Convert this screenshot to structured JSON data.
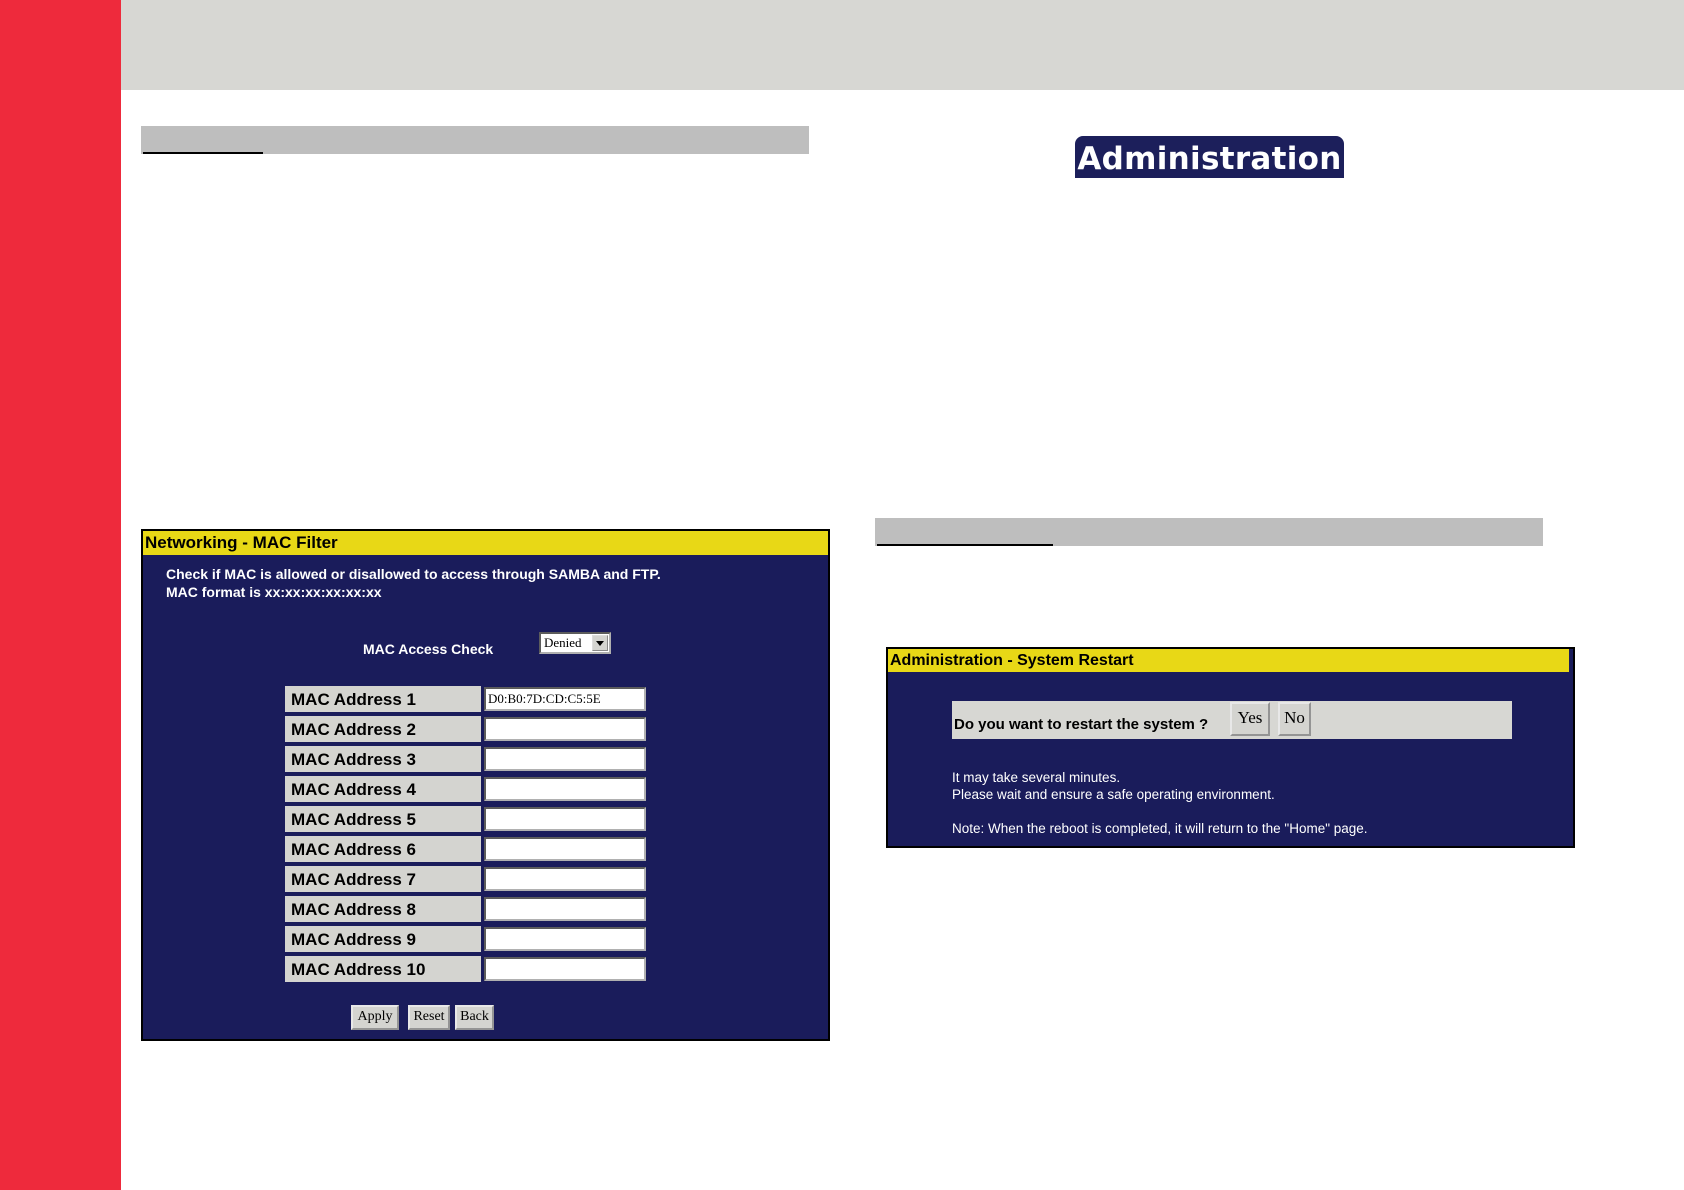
{
  "left_section": {
    "mac_filter": {
      "title": "Networking - MAC Filter",
      "description_line1": "Check if MAC is allowed or disallowed to access through SAMBA and FTP.",
      "description_line2": "MAC format is xx:xx:xx:xx:xx:xx",
      "access_check_label": "MAC Access Check",
      "access_check_value": "Denied",
      "addresses": [
        {
          "label": "MAC Address 1",
          "value": "D0:B0:7D:CD:C5:5E"
        },
        {
          "label": "MAC Address 2",
          "value": ""
        },
        {
          "label": "MAC Address 3",
          "value": ""
        },
        {
          "label": "MAC Address 4",
          "value": ""
        },
        {
          "label": "MAC Address 5",
          "value": ""
        },
        {
          "label": "MAC Address 6",
          "value": ""
        },
        {
          "label": "MAC Address 7",
          "value": ""
        },
        {
          "label": "MAC Address 8",
          "value": ""
        },
        {
          "label": "MAC Address 9",
          "value": ""
        },
        {
          "label": "MAC Address 10",
          "value": ""
        }
      ],
      "buttons": {
        "apply": "Apply",
        "reset": "Reset",
        "back": "Back"
      }
    }
  },
  "right_section": {
    "badge": "Administration",
    "restart": {
      "title": "Administration - System Restart",
      "question": "Do you want to restart the system ?",
      "yes": "Yes",
      "no": "No",
      "info_line1": "It may take several minutes.",
      "info_line2": "Please wait and ensure a safe operating environment.",
      "note": "Note: When the reboot is completed, it will return to the \"Home\" page."
    }
  },
  "colors": {
    "side_bar": "#ee2a3c",
    "top_band": "#d7d7d3",
    "panel_bg": "#1a1c5b",
    "panel_title_bg": "#e8d816",
    "badge_bg": "#1c1f5b"
  }
}
